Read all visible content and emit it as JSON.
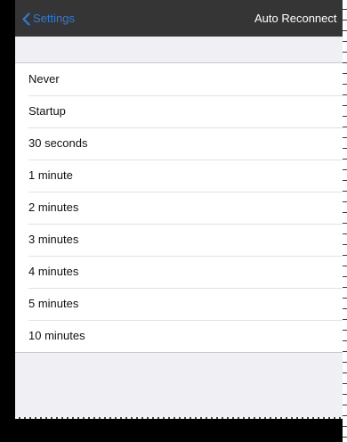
{
  "navbar": {
    "back_label": "Settings",
    "title": "Auto Reconnect"
  },
  "options": [
    {
      "label": "Never"
    },
    {
      "label": "Startup"
    },
    {
      "label": "30 seconds"
    },
    {
      "label": "1 minute"
    },
    {
      "label": "2 minutes"
    },
    {
      "label": "3 minutes"
    },
    {
      "label": "4 minutes"
    },
    {
      "label": "5 minutes"
    },
    {
      "label": "10 minutes"
    }
  ],
  "colors": {
    "navbar_background": "#353535",
    "back_label": "#2f7ad6",
    "screen_background": "#efeff4",
    "list_background": "#ffffff"
  }
}
